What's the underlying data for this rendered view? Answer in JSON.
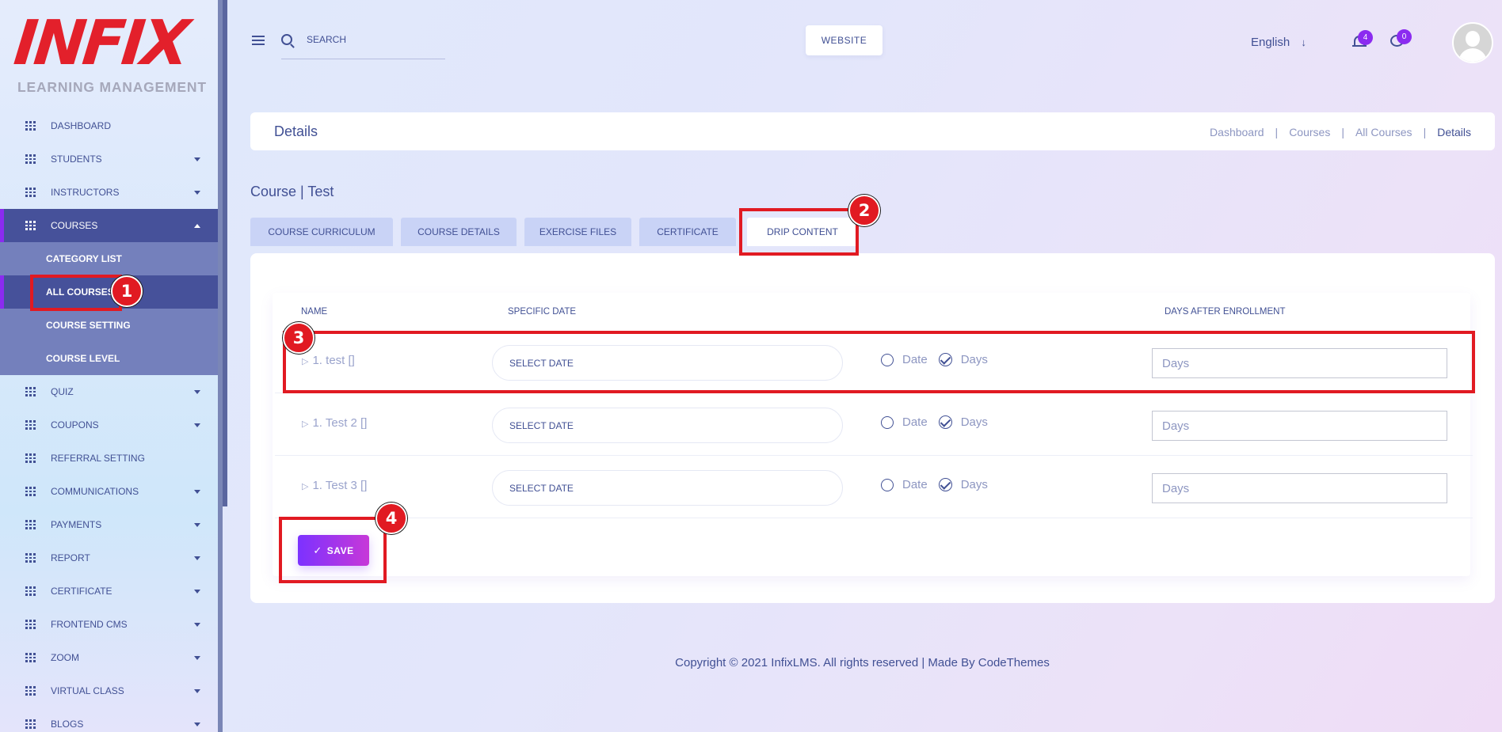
{
  "logo": {
    "mark": "INFIX",
    "subtitle": "LEARNING MANAGEMENT"
  },
  "sidebar": {
    "items": [
      {
        "label": "DASHBOARD",
        "has_caret": false
      },
      {
        "label": "STUDENTS",
        "has_caret": true
      },
      {
        "label": "INSTRUCTORS",
        "has_caret": true
      },
      {
        "label": "COURSES",
        "has_caret": true,
        "active": true
      },
      {
        "label": "QUIZ",
        "has_caret": true
      },
      {
        "label": "COUPONS",
        "has_caret": true
      },
      {
        "label": "REFERRAL SETTING",
        "has_caret": false
      },
      {
        "label": "COMMUNICATIONS",
        "has_caret": true
      },
      {
        "label": "PAYMENTS",
        "has_caret": true
      },
      {
        "label": "REPORT",
        "has_caret": true
      },
      {
        "label": "CERTIFICATE",
        "has_caret": true
      },
      {
        "label": "FRONTEND CMS",
        "has_caret": true
      },
      {
        "label": "ZOOM",
        "has_caret": true
      },
      {
        "label": "VIRTUAL CLASS",
        "has_caret": true
      },
      {
        "label": "BLOGS",
        "has_caret": true
      }
    ],
    "courses_submenu": [
      {
        "label": "CATEGORY LIST"
      },
      {
        "label": "ALL COURSES",
        "active": true
      },
      {
        "label": "COURSE SETTING"
      },
      {
        "label": "COURSE LEVEL"
      }
    ]
  },
  "header": {
    "search_placeholder": "SEARCH",
    "website_label": "WEBSITE",
    "language": "English",
    "language_arrow": "↓",
    "notification_count": "4",
    "message_count": "0"
  },
  "page": {
    "title": "Details",
    "breadcrumb": [
      "Dashboard",
      "Courses",
      "All Courses",
      "Details"
    ],
    "breadcrumb_sep": "|",
    "course_title": "Course | Test"
  },
  "tabs": [
    "COURSE CURRICULUM",
    "COURSE DETAILS",
    "EXERCISE FILES",
    "CERTIFICATE",
    "DRIP CONTENT"
  ],
  "table": {
    "headers": {
      "name": "NAME",
      "specific_date": "SPECIFIC DATE",
      "days_after": "DAYS AFTER ENROLLMENT"
    },
    "rows": [
      {
        "lesson": "1. test []",
        "date_label": "SELECT DATE",
        "opt_date": "Date",
        "opt_days": "Days",
        "days_placeholder": "Days"
      },
      {
        "lesson": "1. Test 2 []",
        "date_label": "SELECT DATE",
        "opt_date": "Date",
        "opt_days": "Days",
        "days_placeholder": "Days"
      },
      {
        "lesson": "1. Test 3 []",
        "date_label": "SELECT DATE",
        "opt_date": "Date",
        "opt_days": "Days",
        "days_placeholder": "Days"
      }
    ],
    "play_glyph": "▷"
  },
  "save_label": "SAVE",
  "save_tick": "✓",
  "footer": "Copyright © 2021 InfixLMS. All rights reserved | Made By CodeThemes",
  "annotations": [
    "1",
    "2",
    "3",
    "4"
  ],
  "colors": {
    "primary": "#415094",
    "accent": "#7c32ff",
    "highlight": "#e11a22",
    "logo": "#e3202b"
  }
}
